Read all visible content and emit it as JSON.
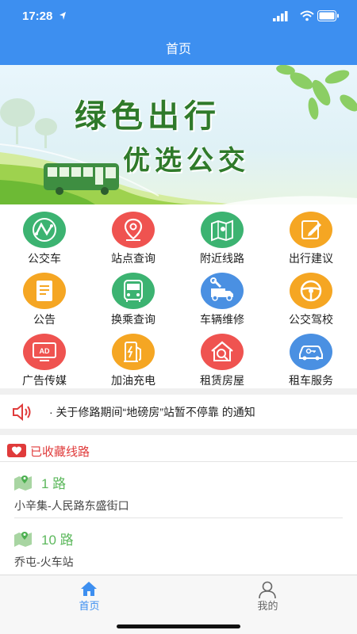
{
  "status_bar": {
    "time": "17:28"
  },
  "nav": {
    "title": "首页"
  },
  "banner": {
    "line1": "绿色出行",
    "line2": "优选公交"
  },
  "grid": [
    {
      "label": "公交车",
      "icon": "route-icon",
      "color": "#3cb371"
    },
    {
      "label": "站点查询",
      "icon": "location-pin-icon",
      "color": "#ef5350"
    },
    {
      "label": "附近线路",
      "icon": "map-icon",
      "color": "#3cb371"
    },
    {
      "label": "出行建议",
      "icon": "edit-icon",
      "color": "#f5a623"
    },
    {
      "label": "公告",
      "icon": "document-icon",
      "color": "#f5a623"
    },
    {
      "label": "换乘查询",
      "icon": "bus-icon",
      "color": "#3cb371"
    },
    {
      "label": "车辆维修",
      "icon": "repair-truck-icon",
      "color": "#4a90e2"
    },
    {
      "label": "公交驾校",
      "icon": "steering-wheel-icon",
      "color": "#f5a623"
    },
    {
      "label": "广告传媒",
      "icon": "ad-screen-icon",
      "color": "#ef5350"
    },
    {
      "label": "加油充电",
      "icon": "fuel-pump-icon",
      "color": "#f5a623"
    },
    {
      "label": "租赁房屋",
      "icon": "house-search-icon",
      "color": "#ef5350"
    },
    {
      "label": "租车服务",
      "icon": "car-key-icon",
      "color": "#4a90e2"
    }
  ],
  "notice": {
    "text": "· 关于修路期间“地磅房”站暂不停靠 的通知"
  },
  "favorites": {
    "title": "已收藏线路",
    "routes": [
      {
        "name": "1 路",
        "stops": "小辛集-人民路东盛街口"
      },
      {
        "name": "10 路",
        "stops": "乔屯-火车站"
      }
    ]
  },
  "tabs": [
    {
      "label": "首页",
      "active": true,
      "color": "#3d8ff0"
    },
    {
      "label": "我的",
      "active": false,
      "color": "#666666"
    }
  ]
}
